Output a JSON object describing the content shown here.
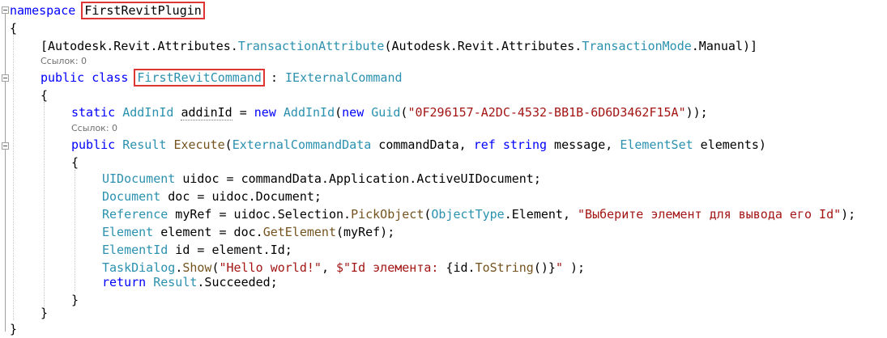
{
  "code": {
    "namespace_kw": "namespace",
    "namespace_name": "FirstRevitPlugin",
    "open_ns": "{",
    "attr_prefix": "[Autodesk.Revit.Attributes.",
    "attr_type": "TransactionAttribute",
    "attr_mid": "(Autodesk.Revit.Attributes.",
    "attr_mode_type": "TransactionMode",
    "attr_suffix": ".Manual)]",
    "lens1": "Ссылок: 0",
    "class_kw": "public class",
    "class_name": "FirstRevitCommand",
    "class_sep": " : ",
    "class_iface": "IExternalCommand",
    "open_class": "{",
    "static_kw": "static",
    "addinid_type": "AddInId",
    "addinid_var": "addinId",
    "addinid_eq": " = ",
    "new_kw": "new",
    "addinid_ctor": "AddInId",
    "paren_open": "(",
    "new_kw2": "new",
    "guid_type": "Guid",
    "guid_paren": "(",
    "guid_str": "\"0F296157-A2DC-4532-BB1B-6D6D3462F15A\"",
    "guid_close": "));",
    "lens2": "Ссылок: 0",
    "public_kw": "public",
    "result_type": "Result",
    "exec_name": "Execute",
    "exec_p1": "(",
    "ecd_type": "ExternalCommandData",
    "ecd_name": " commandData, ",
    "ref_kw": "ref",
    "string_kw": "string",
    "msg_name": " message, ",
    "es_type": "ElementSet",
    "es_name": " elements)",
    "open_method": "{",
    "l1_type": "UIDocument",
    "l1_rest_a": " uidoc = commandData.Application.ActiveUIDocument;",
    "l2_type": "Document",
    "l2_rest": " doc = uidoc.Document;",
    "l3_type": "Reference",
    "l3_rest_a": " myRef = uidoc.Selection.",
    "l3_method": "PickObject",
    "l3_paren": "(",
    "l3_type2": "ObjectType",
    "l3_rest_b": ".Element, ",
    "l3_str": "\"Выберите элемент для вывода его Id\"",
    "l3_end": ");",
    "l4_type": "Element",
    "l4_rest_a": " element = doc.",
    "l4_method": "GetElement",
    "l4_rest_b": "(myRef);",
    "l5_type": "ElementId",
    "l5_rest": " id = element.Id;",
    "l6_type": "TaskDialog",
    "l6_dot": ".",
    "l6_method": "Show",
    "l6_paren": "(",
    "l6_str1": "\"Hello world!\"",
    "l6_comma": ", ",
    "l6_str2a": "$\"Id элемента: ",
    "l6_interp_open": "{",
    "l6_id": "id.",
    "l6_tostr": "ToString",
    "l6_parens": "()",
    "l6_interp_close": "}",
    "l6_str2b": "\"",
    "l6_end": " );",
    "return_kw": "return",
    "ret_sp": " ",
    "ret_type": "Result",
    "ret_rest": ".Succeeded;",
    "close_method": "}",
    "close_class": "}",
    "close_ns": "}"
  }
}
